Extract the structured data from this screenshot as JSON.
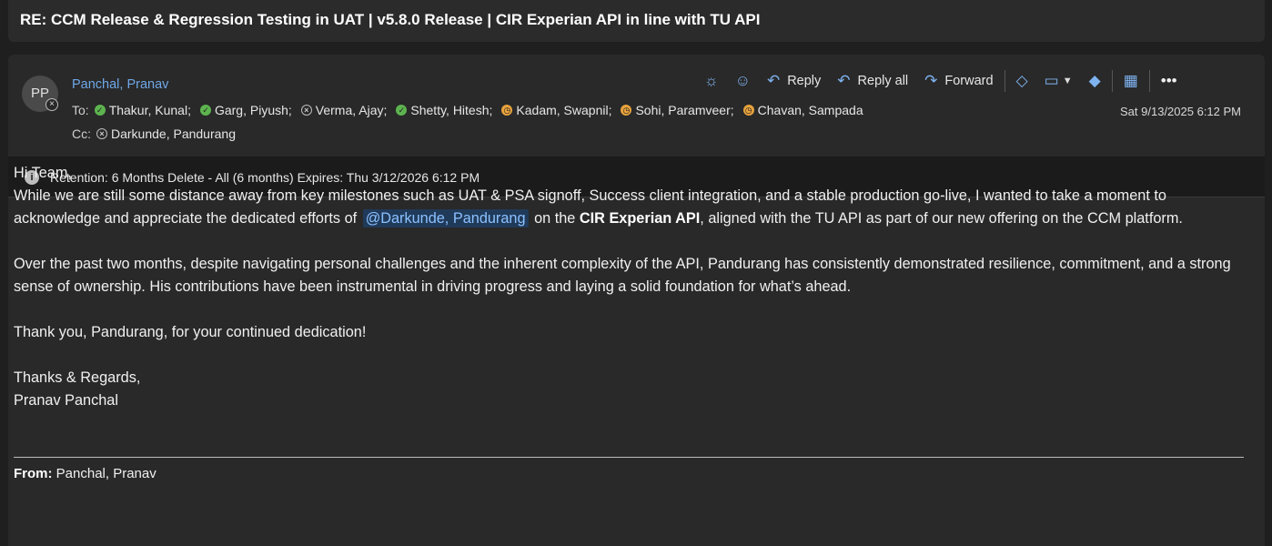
{
  "subject": "RE: CCM Release & Regression Testing in UAT | v5.8.0 Release | CIR Experian API in line with TU API",
  "header": {
    "avatar_initials": "PP",
    "sender_name": "Panchal, Pranav",
    "to_prefix": "To:",
    "cc_prefix": "Cc:",
    "to": [
      {
        "name": "Thakur, Kunal;",
        "status": "available"
      },
      {
        "name": "Garg, Piyush;",
        "status": "available"
      },
      {
        "name": "Verma, Ajay;",
        "status": "offline"
      },
      {
        "name": "Shetty, Hitesh;",
        "status": "available"
      },
      {
        "name": "Kadam, Swapnil;",
        "status": "away"
      },
      {
        "name": "Sohi, Paramveer;",
        "status": "away"
      },
      {
        "name": "Chavan, Sampada",
        "status": "away"
      }
    ],
    "cc": [
      {
        "name": "Darkunde, Pandurang",
        "status": "offline"
      }
    ],
    "date": "Sat 9/13/2025 6:12 PM"
  },
  "toolbar": {
    "reply_label": "Reply",
    "reply_all_label": "Reply all",
    "forward_label": "Forward"
  },
  "retention": {
    "text": "Retention: 6 Months Delete - All (6 months) Expires: Thu 3/12/2026 6:12 PM"
  },
  "body": {
    "greeting": "Hi Team,",
    "p1_a": "While we are still some distance away from key milestones such as UAT & PSA signoff, Success client integration, and a stable production go-live, I wanted to take a moment to acknowledge and appreciate the dedicated efforts of",
    "mention": "@Darkunde, Pandurang",
    "p1_b": "on the",
    "p1_bold": "CIR Experian API",
    "p1_c": ", aligned with the TU API as part of our new offering on the CCM platform.",
    "p2": "Over the past two months, despite navigating personal challenges and the inherent complexity of the API, Pandurang has consistently demonstrated resilience, commitment, and a strong sense of ownership. His contributions have been instrumental in driving progress and laying a solid foundation for what’s ahead.",
    "p3": "Thank you, Pandurang, for your continued dedication!",
    "signoff": "Thanks & Regards,",
    "signature": "Pranav Panchal"
  },
  "quoted": {
    "from_label": "From:",
    "from_value": "Panchal, Pranav"
  }
}
